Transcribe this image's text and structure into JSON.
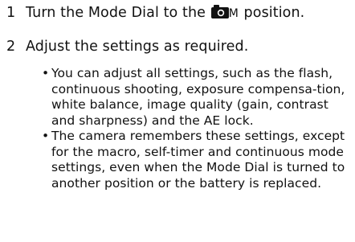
{
  "steps": [
    {
      "number": "1",
      "text_before": "Turn the Mode Dial to the ",
      "icon": "camera-icon",
      "mode_suffix": "M",
      "text_after": " position."
    },
    {
      "number": "2",
      "text": "Adjust the settings as required."
    }
  ],
  "bullets": [
    "You can adjust all settings, such as the flash, continuous shooting, exposure compensa-tion, white balance, image quality (gain, contrast and sharpness) and the AE lock.",
    "The camera remembers these settings, except for the macro, self-timer and continuous mode settings, even when the Mode Dial is turned to another position or the battery is replaced."
  ],
  "bullet_char": "•",
  "colors": {
    "text": "#111111",
    "background": "#ffffff"
  }
}
